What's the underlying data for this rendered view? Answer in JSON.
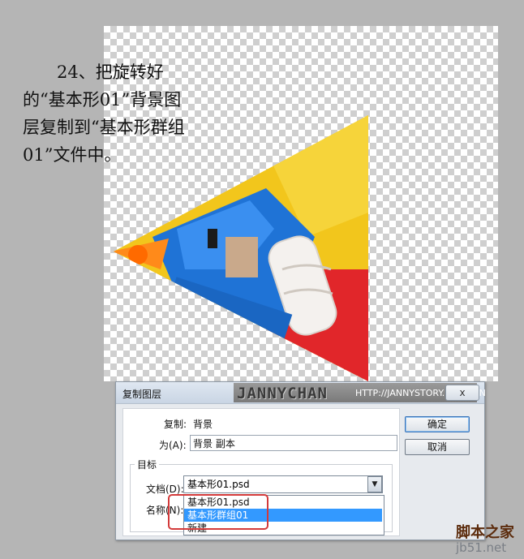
{
  "instruction_text": "24、把旋转好的“基本形01”背景图层复制到“基本形群组01”文件中。",
  "dialog": {
    "title": "复制图层",
    "close_label": "x",
    "copy_label": "复制:",
    "copy_value": "背景",
    "as_label": "为(A):",
    "as_value": "背景 副本",
    "target_label": "目标",
    "document_label": "文档(D):",
    "document_value": "基本形01.psd",
    "name_label": "名称(N):",
    "ok_label": "确定",
    "cancel_label": "取消"
  },
  "dropdown": {
    "options": [
      "基本形01.psd",
      "基本形群组01",
      "新建"
    ],
    "selected_index": 1
  },
  "watermark": {
    "brand": "JANNYCHAN",
    "url": "HTTP://JANNYSTORY.POCO.CN"
  },
  "site_logo": {
    "main": "脚本之家",
    "sub": "jb51.net"
  },
  "colors": {
    "selection": "#3399ff",
    "highlight": "#d33a3a"
  }
}
